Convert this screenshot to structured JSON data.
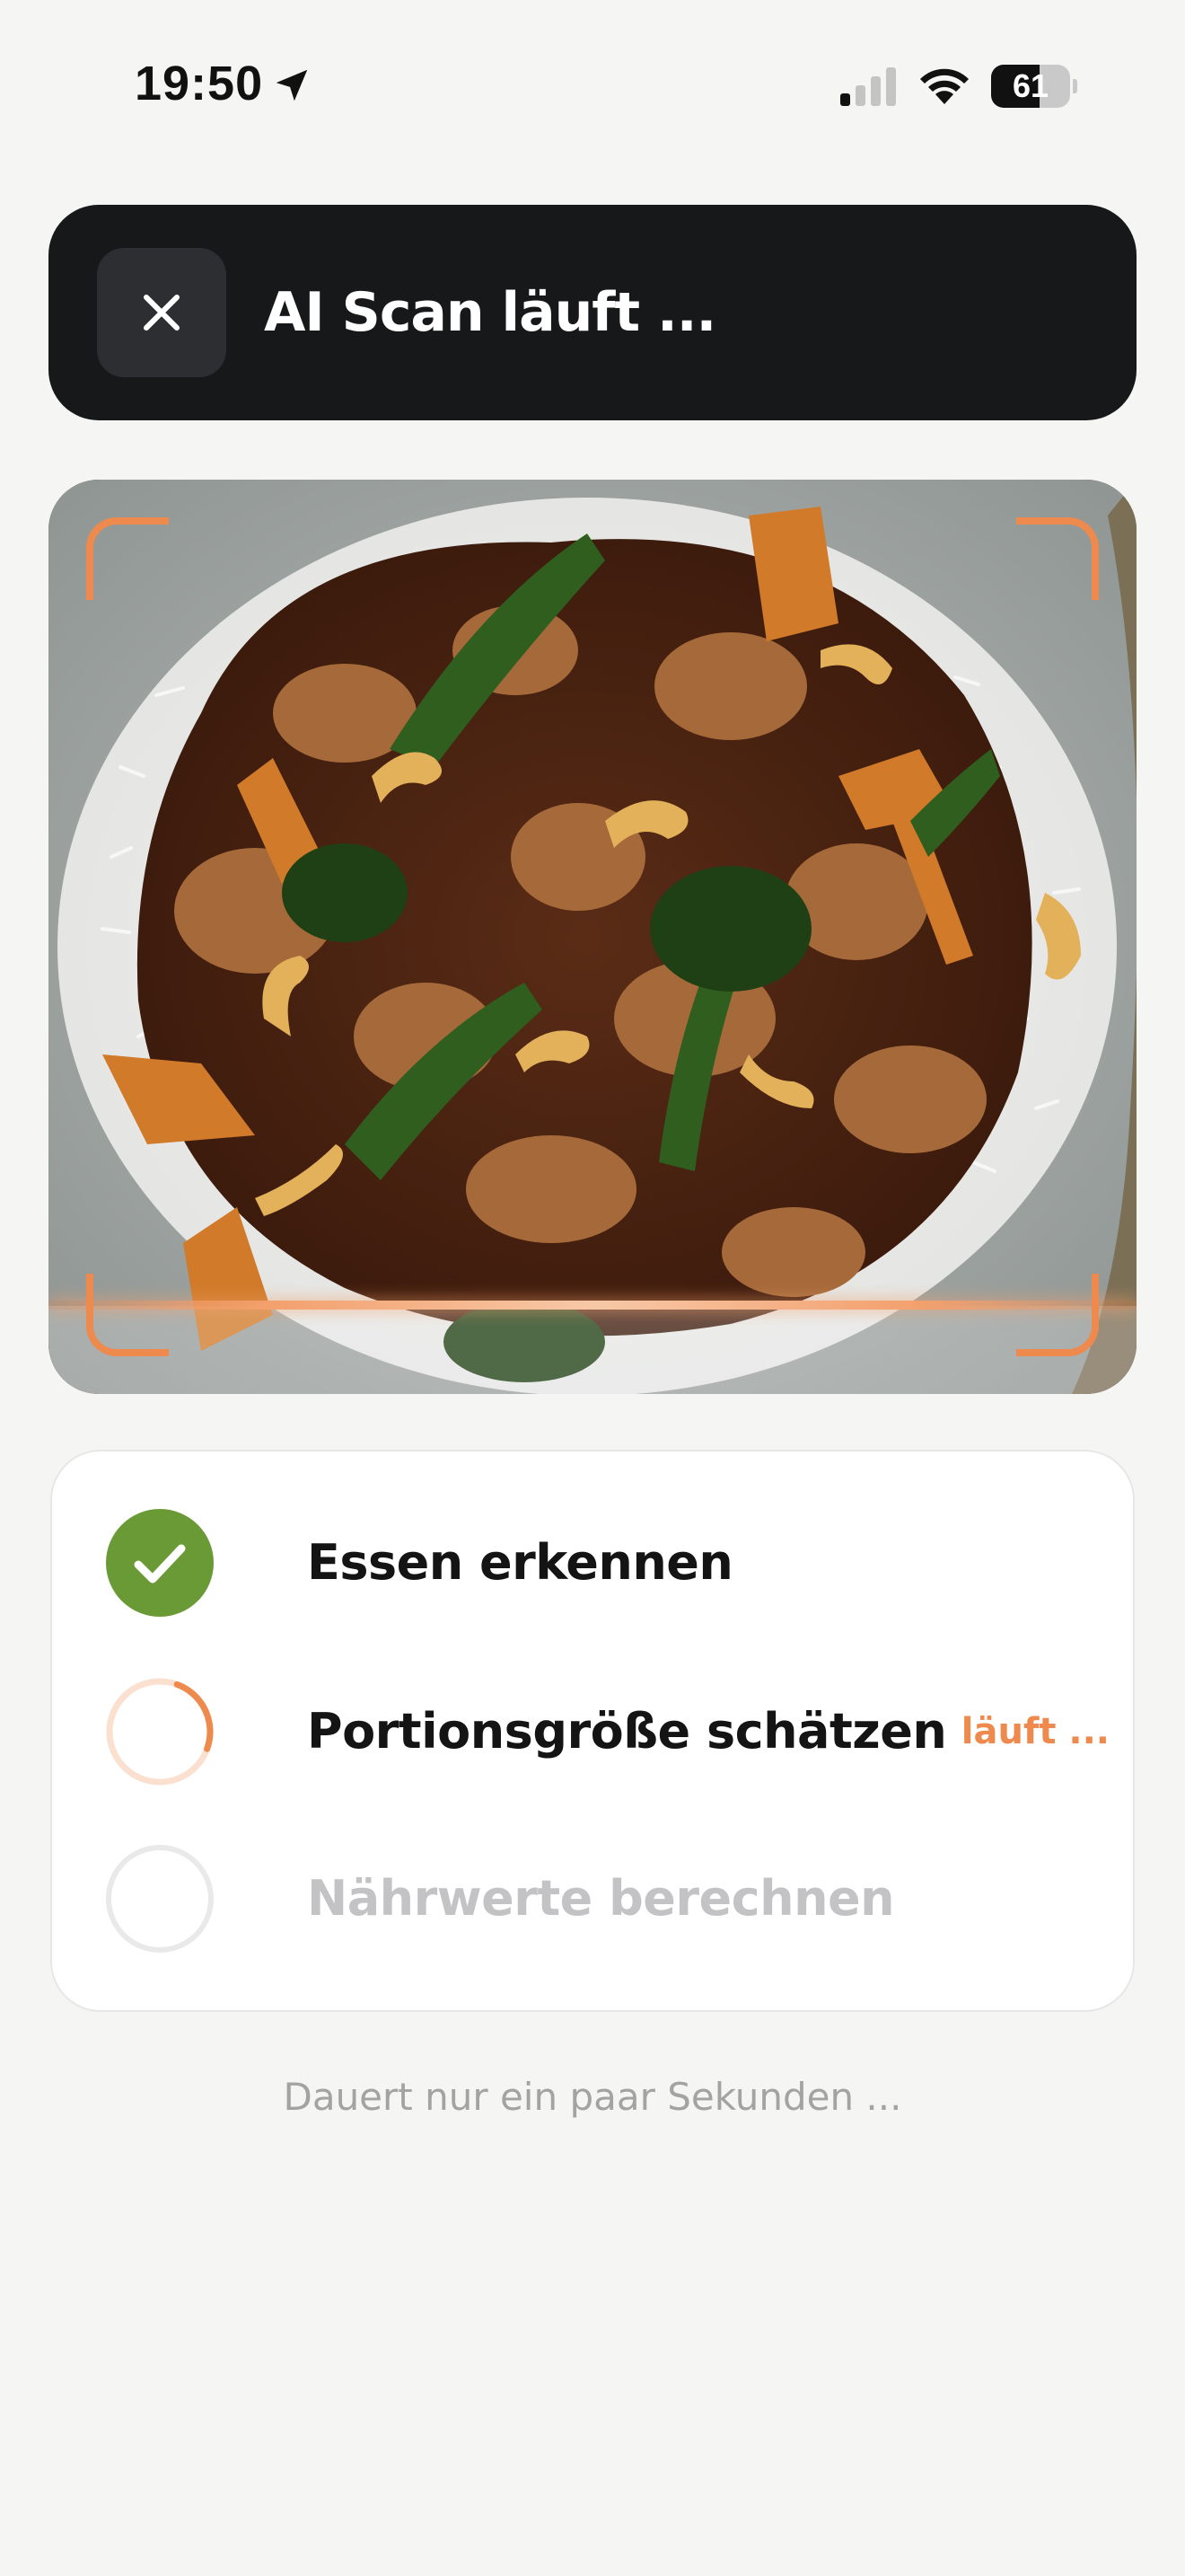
{
  "status_bar": {
    "time": "19:50",
    "battery_percent": "61",
    "battery_level": 0.61,
    "icons": [
      "location-arrow-icon",
      "cellular-signal-icon",
      "wifi-icon",
      "battery-icon"
    ]
  },
  "header": {
    "close_icon": "close-icon",
    "title": "AI Scan läuft ..."
  },
  "scan": {
    "image_subject": "food-photo",
    "scan_line_color": "#ee8a4d"
  },
  "steps": [
    {
      "label": "Essen erkennen",
      "state": "done",
      "status_text": ""
    },
    {
      "label": "Portionsgröße schätzen",
      "state": "running",
      "status_text": "läuft ...",
      "progress": 0.25
    },
    {
      "label": "Nährwerte berechnen",
      "state": "pending",
      "status_text": ""
    }
  ],
  "footnote": "Dauert nur ein paar Sekunden ...",
  "colors": {
    "background": "#f5f5f4",
    "header_bg": "#17181a",
    "accent_orange": "#ee8a4d",
    "success_green": "#6a9a35",
    "muted_text": "#c3c3c6"
  }
}
